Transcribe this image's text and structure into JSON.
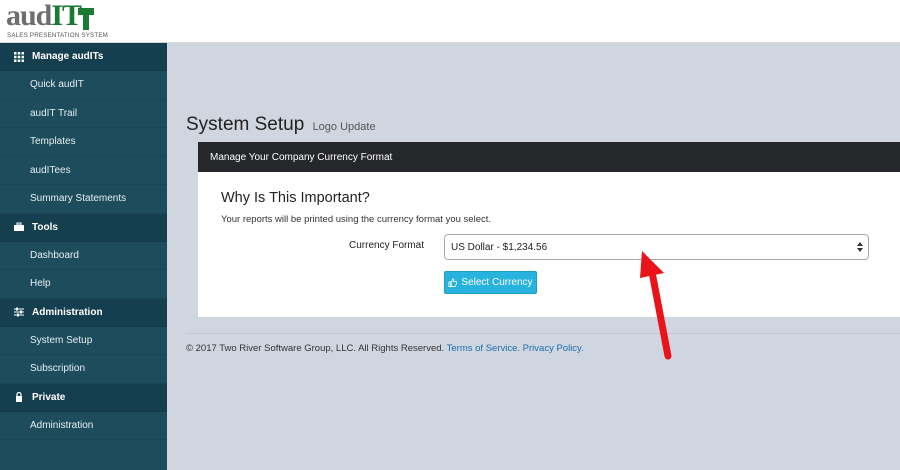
{
  "brand": {
    "logo_text_a": "aud",
    "logo_text_b": "IT",
    "tagline": "SALES PRESENTATION SYSTEM",
    "colors": {
      "gray": "#6d6e70",
      "green": "#1a7a33"
    }
  },
  "sidebar": {
    "sections": [
      {
        "label": "Manage audITs",
        "icon": "grid-icon",
        "items": [
          {
            "label": "Quick audIT"
          },
          {
            "label": "audIT Trail"
          },
          {
            "label": "Templates"
          },
          {
            "label": "audITees"
          },
          {
            "label": "Summary Statements"
          }
        ]
      },
      {
        "label": "Tools",
        "icon": "toolbox-icon",
        "items": [
          {
            "label": "Dashboard"
          },
          {
            "label": "Help"
          }
        ]
      },
      {
        "label": "Administration",
        "icon": "sliders-icon",
        "items": [
          {
            "label": "System Setup"
          },
          {
            "label": "Subscription"
          }
        ]
      },
      {
        "label": "Private",
        "icon": "lock-icon",
        "items": [
          {
            "label": "Administration"
          }
        ]
      }
    ]
  },
  "page": {
    "title": "System Setup",
    "subtitle": "Logo Update"
  },
  "card": {
    "header": "Manage Your Company Currency Format",
    "heading": "Why Is This Important?",
    "description": "Your reports will be printed using the currency format you select.",
    "field_label": "Currency Format",
    "select_value": "US Dollar - $1,234.56",
    "button_label": "Select Currency"
  },
  "footer": {
    "copyright": "© 2017 Two River Software Group, LLC. All Rights Reserved.",
    "terms": "Terms of Service.",
    "privacy": "Privacy Policy."
  },
  "colors": {
    "sidebar_bg": "#1d4d5d",
    "sidebar_section_bg": "#153f4f",
    "main_bg": "#d0d6e0",
    "card_header_bg": "#25272a",
    "button_bg": "#28b3de",
    "link": "#1b6fb0",
    "annotation_arrow": "#e8141a"
  }
}
